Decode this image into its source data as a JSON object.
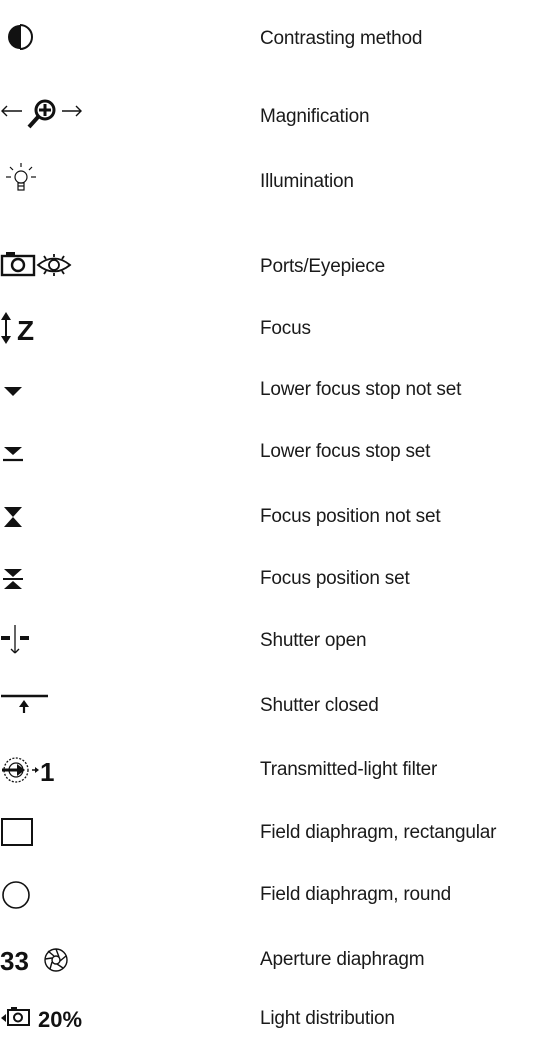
{
  "legend": [
    {
      "icon": "contrasting-method-icon",
      "label": "Contrasting method"
    },
    {
      "icon": "magnification-icon",
      "label": "Magnification"
    },
    {
      "icon": "illumination-bulb-icon",
      "label": "Illumination"
    },
    {
      "icon": "camera-eye-icon",
      "label": "Ports/Eyepiece"
    },
    {
      "icon": "focus-z-icon",
      "label": "Focus",
      "icon_text": "Z"
    },
    {
      "icon": "triangle-down-icon",
      "label": "Lower focus stop not set"
    },
    {
      "icon": "triangle-down-bar-icon",
      "label": "Lower focus stop set"
    },
    {
      "icon": "hourglass-icon",
      "label": "Focus position not set"
    },
    {
      "icon": "hourglass-bar-icon",
      "label": "Focus position set"
    },
    {
      "icon": "shutter-open-icon",
      "label": "Shutter open"
    },
    {
      "icon": "shutter-closed-icon",
      "label": "Shutter closed"
    },
    {
      "icon": "filter-wheel-icon",
      "label": "Transmitted-light filter",
      "icon_text": "1"
    },
    {
      "icon": "rectangle-icon",
      "label": "Field diaphragm, rectangular"
    },
    {
      "icon": "circle-icon",
      "label": "Field diaphragm, round"
    },
    {
      "icon": "aperture-icon",
      "label": "Aperture diaphragm",
      "icon_text": "33"
    },
    {
      "icon": "camera-percent-icon",
      "label": "Light distribution",
      "icon_text": "20%"
    }
  ]
}
